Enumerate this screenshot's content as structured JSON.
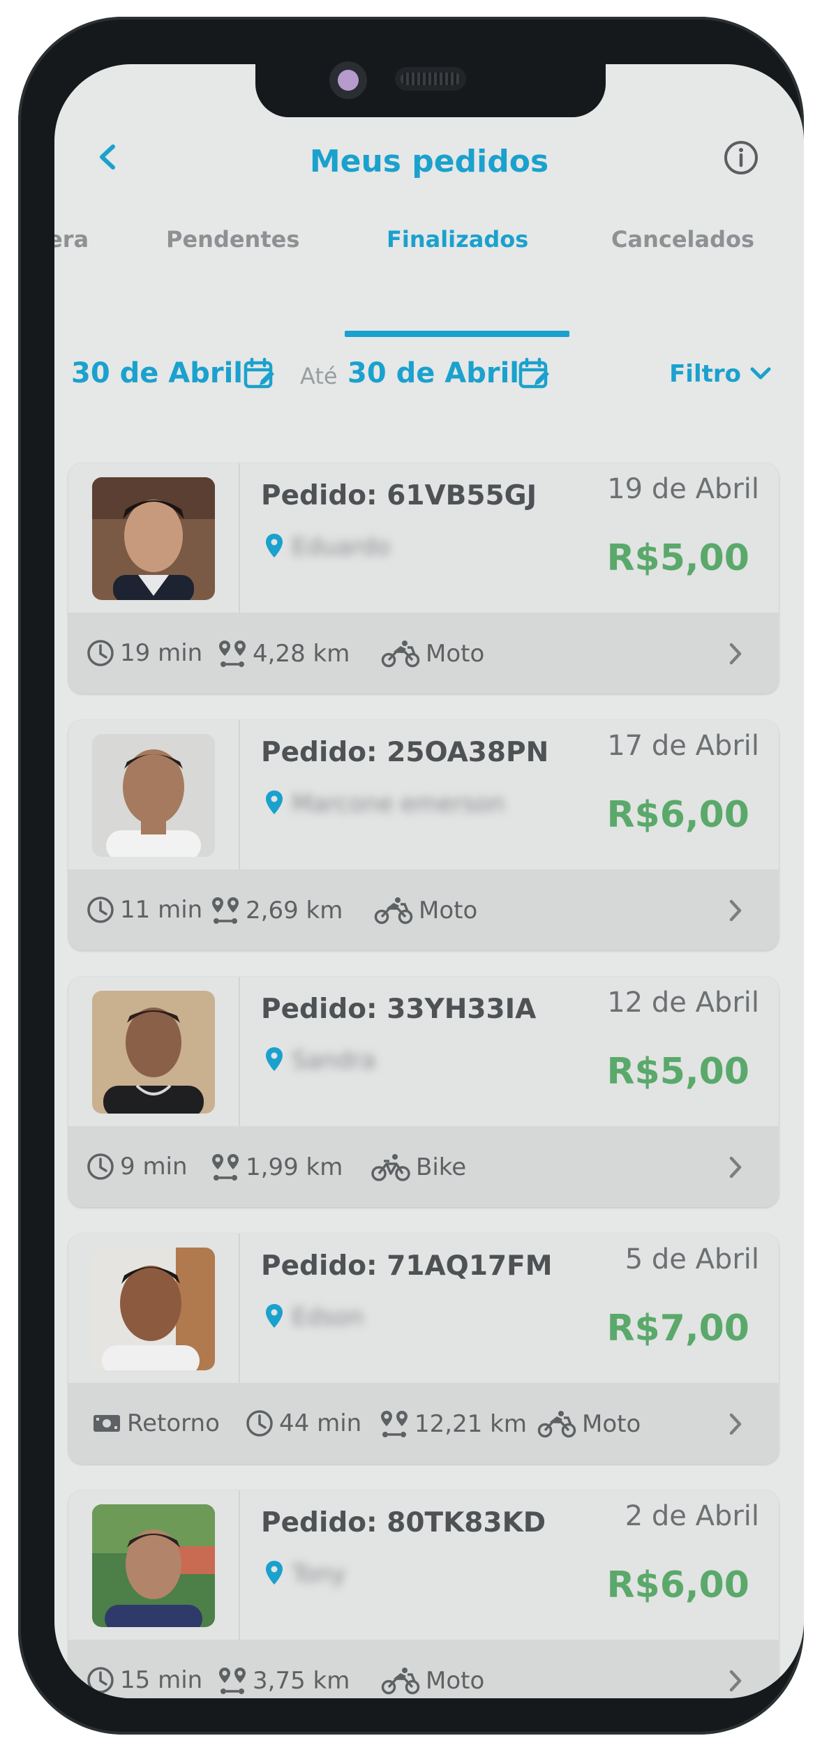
{
  "header": {
    "title": "Meus pedidos"
  },
  "tabs": [
    {
      "label": "era"
    },
    {
      "label": "Pendentes"
    },
    {
      "label": "Finalizados",
      "active": true
    },
    {
      "label": "Cancelados"
    }
  ],
  "date_range": {
    "from": "30 de Abril",
    "separator": "Até",
    "to": "30 de Abril",
    "filter_label": "Filtro"
  },
  "colors": {
    "accent": "#1aa1cd",
    "price": "#5aa96b"
  },
  "orders": [
    {
      "pedido": "Pedido: 61VB55GJ",
      "date": "19 de Abril",
      "price": "R$5,00",
      "time": "19 min",
      "distance": "4,28 km",
      "vehicle": "Moto",
      "vehicle_icon": "motorcycle-icon",
      "name_blurred": "Eduardo"
    },
    {
      "pedido": "Pedido: 25OA38PN",
      "date": "17 de Abril",
      "price": "R$6,00",
      "time": "11 min",
      "distance": "2,69 km",
      "vehicle": "Moto",
      "vehicle_icon": "motorcycle-icon",
      "name_blurred": "Marcone emerson"
    },
    {
      "pedido": "Pedido: 33YH33IA",
      "date": "12 de Abril",
      "price": "R$5,00",
      "time": "9 min",
      "distance": "1,99 km",
      "vehicle": "Bike",
      "vehicle_icon": "bicycle-icon",
      "name_blurred": "Sandra"
    },
    {
      "pedido": "Pedido: 71AQ17FM",
      "date": "5 de Abril",
      "price": "R$7,00",
      "retorno": "Retorno",
      "time": "44 min",
      "distance": "12,21 km",
      "vehicle": "Moto",
      "vehicle_icon": "motorcycle-icon",
      "name_blurred": "Edson"
    },
    {
      "pedido": "Pedido: 80TK83KD",
      "date": "2 de Abril",
      "price": "R$6,00",
      "time": "15 min",
      "distance": "3,75 km",
      "vehicle": "Moto",
      "vehicle_icon": "motorcycle-icon",
      "name_blurred": "Tony"
    }
  ]
}
